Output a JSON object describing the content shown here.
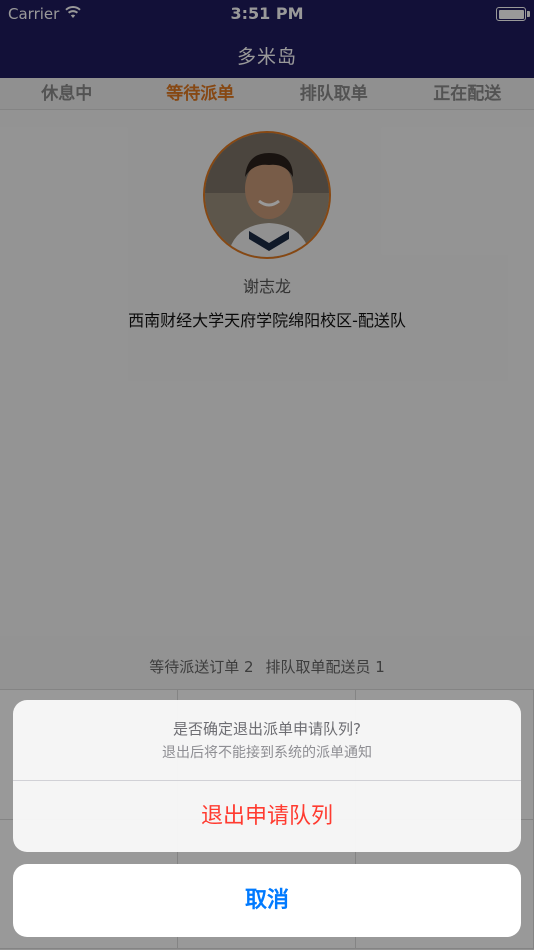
{
  "status_bar": {
    "carrier": "Carrier",
    "time": "3:51 PM"
  },
  "nav": {
    "title": "多米岛"
  },
  "tabs": [
    {
      "label": "休息中",
      "active": false
    },
    {
      "label": "等待派单",
      "active": true
    },
    {
      "label": "排队取单",
      "active": false
    },
    {
      "label": "正在配送",
      "active": false
    }
  ],
  "profile": {
    "name": "谢志龙",
    "team": "西南财经大学天府学院绵阳校区-配送队"
  },
  "stats": {
    "waiting_orders": "等待派送订单 2",
    "queue_couriers": "排队取单配送员 1"
  },
  "action_sheet": {
    "title": "是否确定退出派单申请队列?",
    "message": "退出后将不能接到系统的派单通知",
    "destructive_label": "退出申请队列",
    "cancel_label": "取消"
  },
  "colors": {
    "nav": "#1f1b5e",
    "accent": "#e07820",
    "destructive": "#ff3b30",
    "link": "#007aff"
  }
}
